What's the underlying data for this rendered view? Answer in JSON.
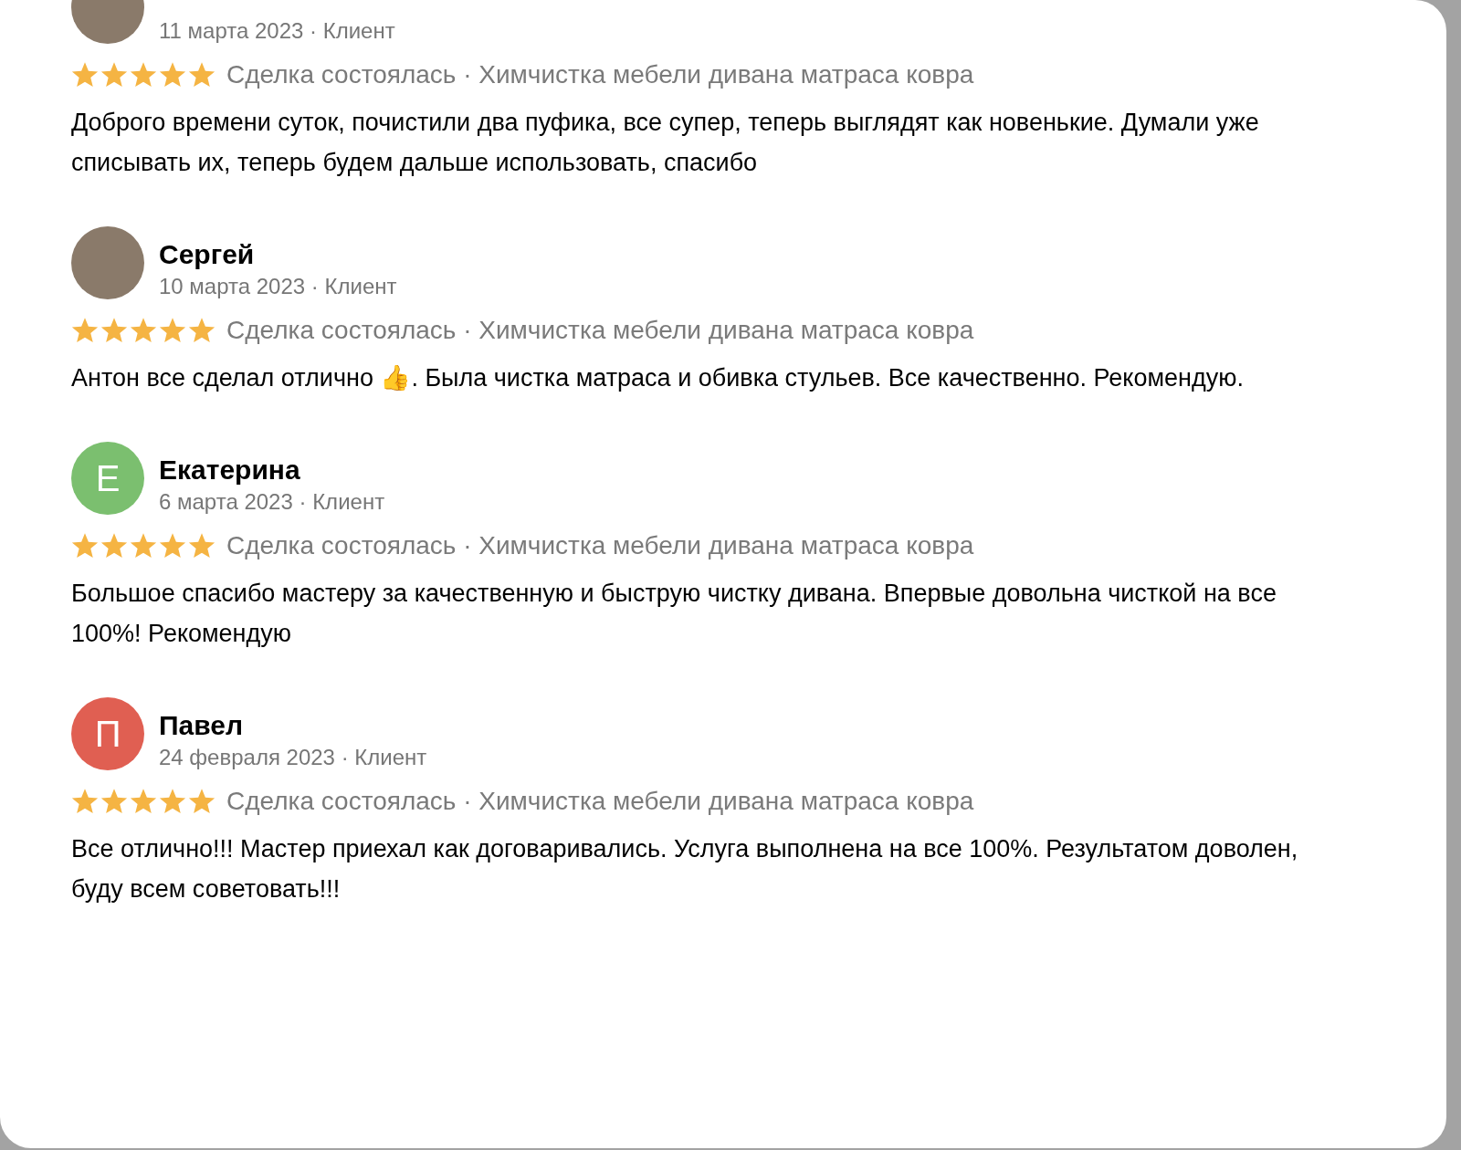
{
  "reviews": [
    {
      "avatar": {
        "kind": "photo"
      },
      "date": "11 марта 2023 · Клиент",
      "stars": 5,
      "deal": "Сделка состоялась · Химчистка мебели дивана матраса ковра",
      "text": "Доброго времени суток, почистили два пуфика, все супер, теперь выглядят как новенькие. Думали уже списывать их, теперь будем дальше использовать, спасибо"
    },
    {
      "avatar": {
        "kind": "photo"
      },
      "name": "Сергей",
      "date": "10 марта 2023 · Клиент",
      "stars": 5,
      "deal": "Сделка состоялась · Химчистка мебели дивана матраса ковра",
      "text": "Антон все сделал отлично 👍. Была чистка матраса и обивка стульев. Все качественно. Рекомендую."
    },
    {
      "avatar": {
        "kind": "letter",
        "letter": "Е",
        "color": "#7bbf6f"
      },
      "name": "Екатерина",
      "date": "6 марта 2023 · Клиент",
      "stars": 5,
      "deal": "Сделка состоялась · Химчистка мебели дивана матраса ковра",
      "text": "Большое спасибо мастеру за качественную и быструю чистку дивана. Впервые довольна чисткой на все 100%! Рекомендую"
    },
    {
      "avatar": {
        "kind": "letter",
        "letter": "П",
        "color": "#e05f52"
      },
      "name": "Павел",
      "date": "24 февраля 2023 · Клиент",
      "stars": 5,
      "deal": "Сделка состоялась · Химчистка мебели дивана матраса ковра",
      "text": "Все отлично!!! Мастер приехал как договаривались. Услуга выполнена на все 100%. Результатом доволен, буду всем советовать!!!"
    }
  ]
}
